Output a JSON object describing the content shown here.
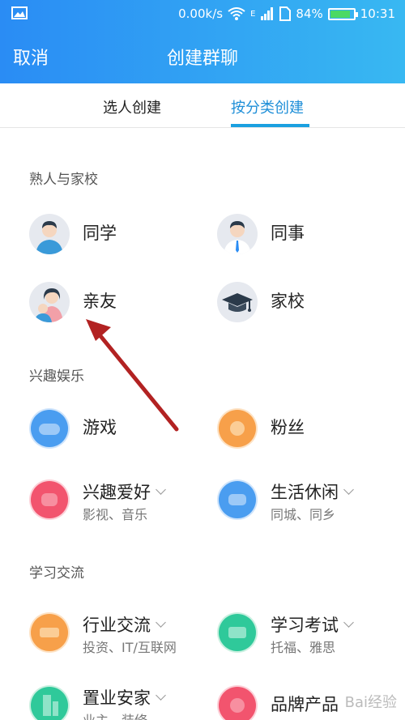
{
  "status": {
    "speed": "0.00k/s",
    "net": "E",
    "battery": "84%",
    "battery_level": 0.84,
    "time": "10:31"
  },
  "nav": {
    "cancel": "取消",
    "title": "创建群聊"
  },
  "tabs": {
    "people": "选人创建",
    "category": "按分类创建"
  },
  "sections": {
    "acquaintance": "熟人与家校",
    "interest": "兴趣娱乐",
    "study": "学习交流"
  },
  "items": {
    "classmate": "同学",
    "colleague": "同事",
    "relatives": "亲友",
    "school": "家校",
    "game": "游戏",
    "fans": "粉丝",
    "hobby": "兴趣爱好",
    "hobby_sub": "影视、音乐",
    "life": "生活休闲",
    "life_sub": "同城、同乡",
    "industry": "行业交流",
    "industry_sub": "投资、IT/互联网",
    "exam": "学习考试",
    "exam_sub": "托福、雅思",
    "property": "置业安家",
    "property_sub": "业主、装修",
    "brand": "品牌产品"
  },
  "colors": {
    "header_start": "#2a8cf4",
    "header_end": "#38b8f2",
    "tab_active": "#1f8fd8",
    "arrow": "#b22222"
  },
  "watermark": "Bai经验"
}
